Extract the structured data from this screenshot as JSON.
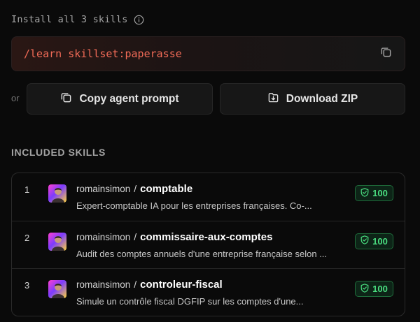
{
  "install": {
    "header": "Install all 3 skills",
    "command": "/learn skillset:paperasse"
  },
  "actions": {
    "or_label": "or",
    "copy_prompt_label": "Copy agent prompt",
    "download_zip_label": "Download ZIP"
  },
  "included": {
    "title": "INCLUDED SKILLS",
    "skills": [
      {
        "index": "1",
        "owner": "romainsimon",
        "separator": "/",
        "name": "comptable",
        "description": "Expert-comptable IA pour les entreprises françaises. Co-...",
        "score": "100"
      },
      {
        "index": "2",
        "owner": "romainsimon",
        "separator": "/",
        "name": "commissaire-aux-comptes",
        "description": "Audit des comptes annuels d'une entreprise française selon ...",
        "score": "100"
      },
      {
        "index": "3",
        "owner": "romainsimon",
        "separator": "/",
        "name": "controleur-fiscal",
        "description": "Simule un contrôle fiscal DGFIP sur les comptes d'une...",
        "score": "100"
      }
    ]
  },
  "colors": {
    "background": "#0a0a0a",
    "command_text": "#f26b57",
    "badge_green": "#4ade80"
  },
  "icons": {
    "info": "info-icon",
    "copy": "copy-icon",
    "download": "download-icon",
    "shield": "shield-check-icon"
  }
}
